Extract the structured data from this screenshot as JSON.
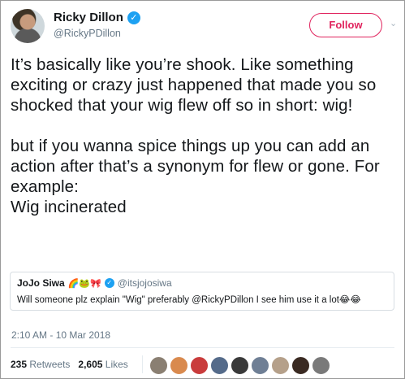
{
  "author": {
    "name": "Ricky Dillon",
    "handle": "@RickyPDillon",
    "verified_icon": "✓",
    "follow_label": "Follow",
    "menu_icon": "chevron-down-icon"
  },
  "tweet": {
    "text": "It’s basically like you’re shook. Like something exciting or crazy just happened that made you so shocked that your wig flew off so in short: wig!\n\nbut if you wanna spice things up you can add an action after that’s a synonym for flew or gone. For example:\nWig incinerated",
    "timestamp": "2:10 AM - 10 Mar 2018"
  },
  "quoted_tweet": {
    "name": "JoJo Siwa",
    "name_emojis": "🌈🐸🎀",
    "handle": "@itsjojosiwa",
    "text": "Will someone plz explain \"Wig\" preferably @RickyPDillon I see him use it a lot😂😂"
  },
  "stats": {
    "retweets_count": "235",
    "retweets_label": "Retweets",
    "likes_count": "2,605",
    "likes_label": "Likes"
  },
  "likers_colors": [
    "#8a7f72",
    "#d98a4e",
    "#c93c3c",
    "#556b8a",
    "#3a3a3a",
    "#6f7f95",
    "#b5a08a",
    "#3a2a22",
    "#7a7a7a"
  ],
  "colors": {
    "accent": "#e0245e",
    "verified": "#1da1f2",
    "secondary_text": "#657786"
  }
}
